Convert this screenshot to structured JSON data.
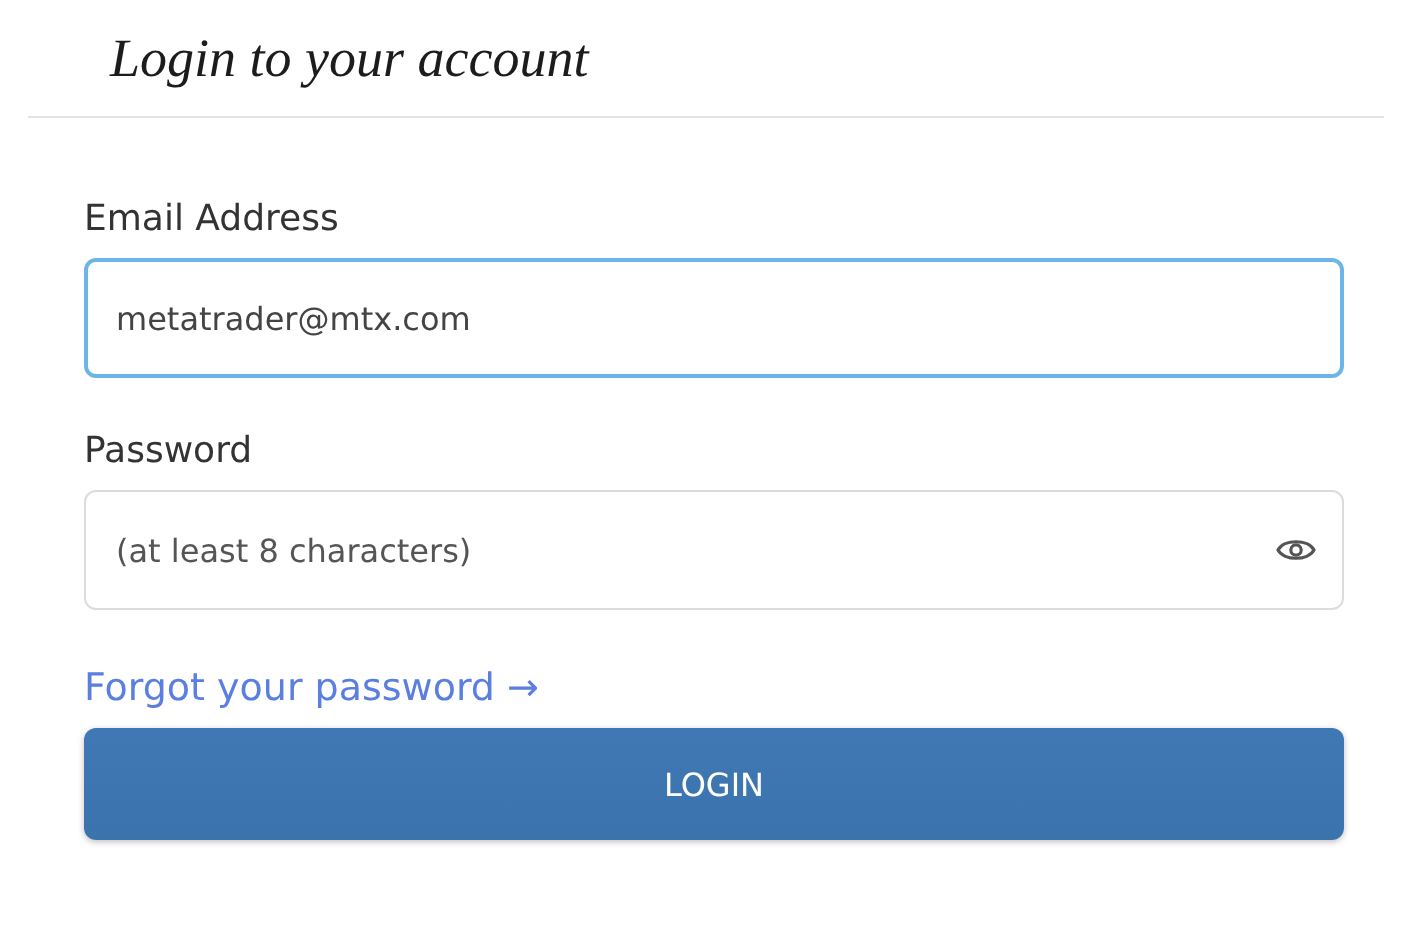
{
  "title": "Login to your account",
  "fields": [
    {
      "label": "Email Address",
      "kind": "text",
      "value": "metatrader@mtx.com",
      "focused": true
    },
    {
      "label": "Password",
      "kind": "password",
      "placeholder": "(at least 8 characters)",
      "focused": false
    }
  ],
  "forgot_link": "Forgot your password →",
  "submit_button": "LOGIN"
}
